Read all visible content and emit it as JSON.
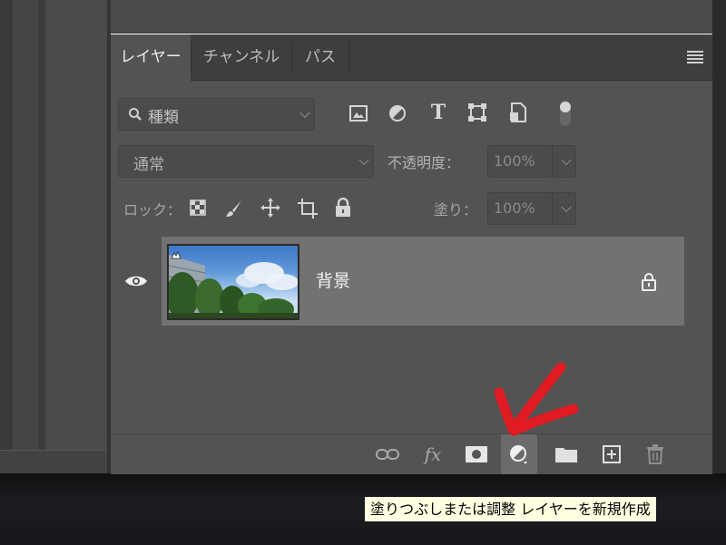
{
  "panel": {
    "tabs": [
      {
        "label": "レイヤー",
        "active": true
      },
      {
        "label": "チャンネル",
        "active": false
      },
      {
        "label": "パス",
        "active": false
      }
    ],
    "menu_icon": "panel-menu-icon"
  },
  "filter": {
    "kind_label": "種類",
    "icons": [
      "image-filter-icon",
      "adjustment-filter-icon",
      "type-filter-icon",
      "shape-filter-icon",
      "smart-object-filter-icon",
      "filter-toggle-icon"
    ]
  },
  "blend": {
    "mode": "通常",
    "opacity_label": "不透明度：",
    "opacity_value": "100%"
  },
  "lock": {
    "label": "ロック：",
    "icons": [
      "lock-transparent-pixels-icon",
      "lock-image-pixels-icon",
      "lock-position-icon",
      "lock-artboard-icon",
      "lock-all-icon"
    ],
    "fill_label": "塗り：",
    "fill_value": "100%"
  },
  "layers": [
    {
      "name": "背景",
      "visible": true,
      "locked": true
    }
  ],
  "footer": {
    "buttons": [
      "link-layers-icon",
      "fx-icon",
      "layer-mask-icon",
      "adjustment-layer-icon",
      "group-folder-icon",
      "new-layer-icon",
      "trash-icon"
    ],
    "fx_text": "fx",
    "hovered": "adjustment-layer-icon"
  },
  "tooltip": {
    "text": "塗りつぶしまたは調整 レイヤーを新規作成"
  },
  "colors": {
    "panel_bg": "#535353",
    "selected_layer": "#727272",
    "annotation_arrow": "#e01b22",
    "tooltip_bg": "#ffffe1"
  }
}
